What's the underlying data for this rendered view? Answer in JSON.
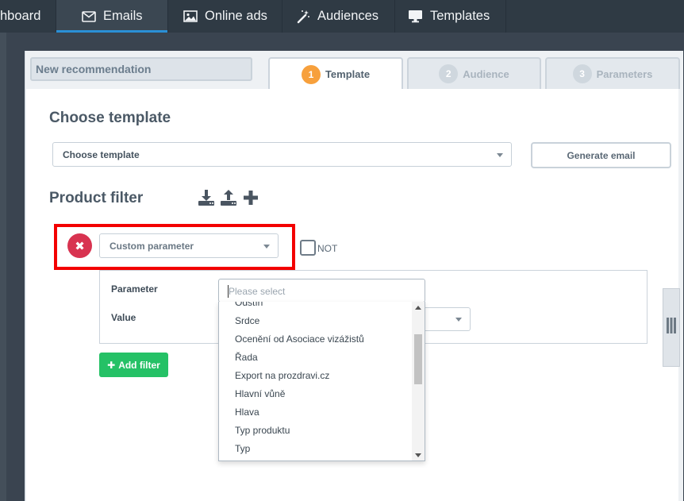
{
  "nav": {
    "tabs": [
      {
        "label": "hboard",
        "icon": "dashboard"
      },
      {
        "label": "Emails",
        "icon": "envelope-icon",
        "active": true
      },
      {
        "label": "Online ads",
        "icon": "image-icon"
      },
      {
        "label": "Audiences",
        "icon": "magic-wand-icon"
      },
      {
        "label": "Templates",
        "icon": "monitor-icon"
      }
    ],
    "accent_color": "#2a8fd6"
  },
  "recommendation_name": "New recommendation",
  "steps": [
    {
      "num": "1",
      "label": "Template",
      "active": true
    },
    {
      "num": "2",
      "label": "Audience",
      "active": false
    },
    {
      "num": "3",
      "label": "Parameters",
      "active": false
    }
  ],
  "template_section": {
    "title": "Choose template",
    "select_value": "Choose template",
    "generate_button": "Generate email"
  },
  "product_filter": {
    "title": "Product filter",
    "icons": [
      "download-icon",
      "upload-icon",
      "plus-icon"
    ],
    "filter_type": "Custom parameter",
    "not_label": "NOT",
    "not_checked": false,
    "parameter_label": "Parameter",
    "value_label": "Value",
    "search_placeholder": "Please select",
    "options": [
      "Odstín",
      "Srdce",
      "Ocenění od Asociace vizážistů",
      "Řada",
      "Export na prozdravi.cz",
      "Hlavní vůně",
      "Hlava",
      "Typ produktu",
      "Typ"
    ],
    "add_filter_label": "Add filter"
  },
  "colors": {
    "step_active": "#f7a03c",
    "remove": "#d83350",
    "add": "#25c166",
    "highlight": "#f30000"
  }
}
